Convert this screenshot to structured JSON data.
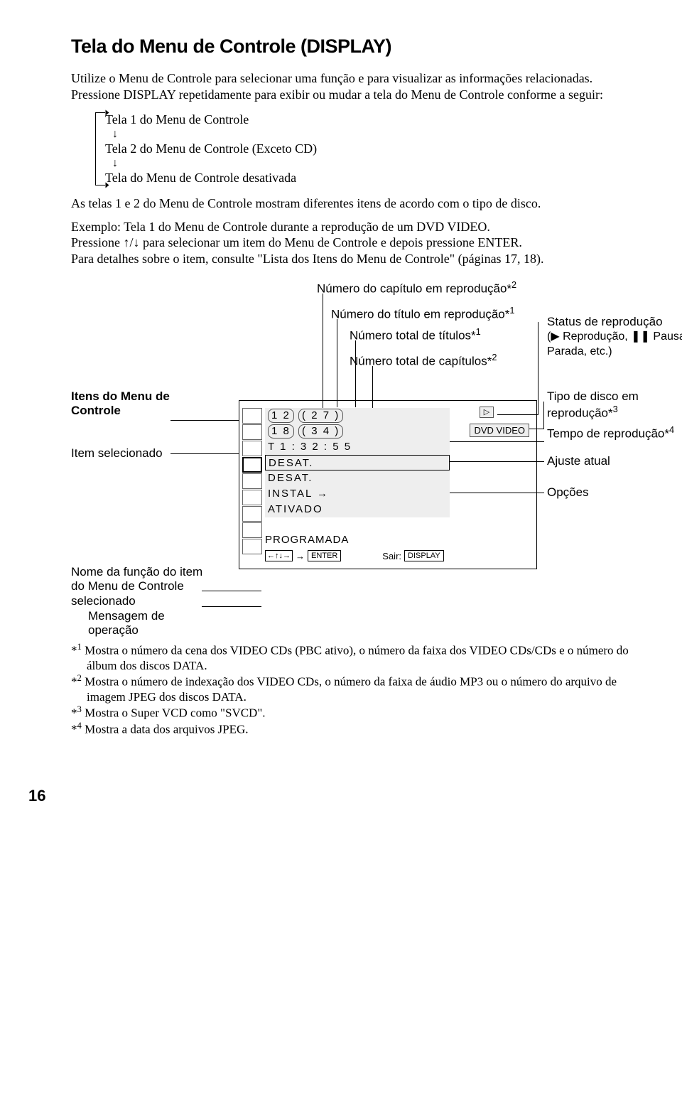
{
  "title": "Tela do Menu de Controle (DISPLAY)",
  "intro": "Utilize o Menu de Controle para selecionar uma função e para visualizar as informações relacionadas. Pressione DISPLAY repetidamente para exibir ou mudar a tela do Menu de Controle conforme a seguir:",
  "flow": {
    "line1": "Tela 1 do Menu de Controle",
    "line2": "Tela 2 do Menu de Controle (Exceto CD)",
    "line3": "Tela do Menu de Controle desativada"
  },
  "para2": "As telas 1 e 2 do Menu de Controle mostram diferentes itens de acordo com o tipo de disco.",
  "para3a": "Exemplo: Tela 1 do Menu de Controle durante a reprodução de um DVD VIDEO.",
  "para3b": "Pressione ↑/↓ para selecionar um item do Menu de Controle e depois pressione ENTER.",
  "para3c": "Para detalhes sobre o item, consulte \"Lista dos Itens do Menu de Controle\" (páginas 17, 18).",
  "callouts": {
    "c1": "Número do capítulo em reprodução*",
    "c1sup": "2",
    "c2": "Número do título em reprodução*",
    "c2sup": "1",
    "c3": "Número total de títulos*",
    "c3sup": "1",
    "c4": "Número total de capítulos*",
    "c4sup": "2",
    "left_items": "Itens do Menu de Controle",
    "left_sel": "Item selecionado",
    "left_func": "Nome da função do item do Menu de Controle selecionado",
    "left_msg": "Mensagem de operação",
    "r_status": "Status de reprodução",
    "r_status2": "(▶ Reprodução, ❚❚ Pausa, ■ Parada, etc.)",
    "r_disctype": "Tipo de disco em reprodução*",
    "r_disctype_sup": "3",
    "r_time": "Tempo de reprodução*",
    "r_time_sup": "4",
    "r_adjust": "Ajuste atual",
    "r_options": "Opções"
  },
  "display": {
    "row1_a": "1 2",
    "row1_b": "( 2 7 )",
    "row2_a": "1 8",
    "row2_b": "( 3 4 )",
    "row3": "T     1 : 3 2 : 5 5",
    "row4": "DESAT.",
    "row5": "DESAT.",
    "row6": "INSTAL →",
    "row7": "ATIVADO",
    "dvd": "DVD VIDEO",
    "play": "▷",
    "prog": "PROGRAMADA",
    "enter": "ENTER",
    "exit": "Sair:",
    "display_key": "DISPLAY"
  },
  "footnotes": {
    "f1": "Mostra o número da cena dos VIDEO CDs (PBC ativo), o número da faixa dos VIDEO CDs/CDs e o número do álbum dos discos DATA.",
    "f2": "Mostra o número de indexação dos VIDEO CDs, o número da faixa de áudio MP3 ou o número do arquivo de imagem JPEG dos discos DATA.",
    "f3": "Mostra o Super VCD como \"SVCD\".",
    "f4": "Mostra a data dos arquivos JPEG."
  },
  "page": "16"
}
